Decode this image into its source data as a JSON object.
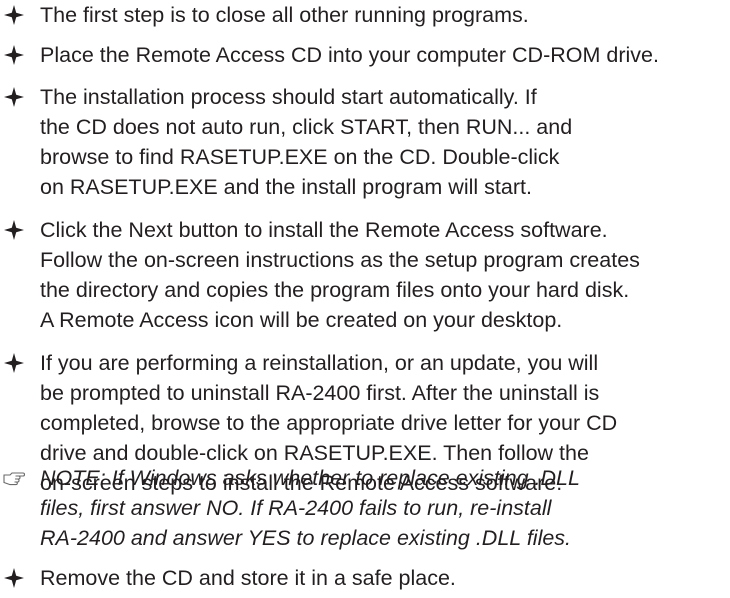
{
  "document": {
    "items": [
      {
        "kind": "step",
        "marker": "four-point-star-icon",
        "lines": [
          "The first step is to close all other running programs."
        ]
      },
      {
        "kind": "step",
        "marker": "four-point-star-icon",
        "lines": [
          "Place the Remote Access CD into your computer CD-ROM drive."
        ]
      },
      {
        "kind": "step",
        "marker": "four-point-star-icon",
        "lines": [
          "The installation process should start automatically. If",
          "the CD does not auto run, click START, then RUN... and",
          "browse to find RASETUP.EXE on the CD. Double-click",
          "on RASETUP.EXE and the install program will start."
        ]
      },
      {
        "kind": "step",
        "marker": "four-point-star-icon",
        "lines": [
          "Click the Next button to install the Remote Access software.",
          "Follow the on-screen instructions as the setup program creates",
          "the directory and copies the program files onto your hard disk.",
          "A Remote Access icon will be created on your desktop."
        ]
      },
      {
        "kind": "step",
        "marker": "four-point-star-icon",
        "lines": [
          "If you are performing a reinstallation, or an update, you will",
          "be prompted to uninstall RA-2400 first. After the uninstall is",
          "completed, browse to the appropriate drive letter for your CD",
          "drive and double-click on RASETUP.EXE. Then follow the",
          "on-screen steps to install the Remote Access software."
        ]
      },
      {
        "kind": "note",
        "marker": "pointing-hand-icon",
        "lines": [
          "NOTE: If Windows asks whether to replace existing .DLL",
          "files, first answer NO. If RA-2400 fails to run, re-install",
          "RA-2400 and answer YES to replace existing .DLL files."
        ]
      },
      {
        "kind": "step",
        "marker": "four-point-star-icon",
        "lines": [
          "Remove the CD and store it in a safe place."
        ]
      }
    ]
  }
}
